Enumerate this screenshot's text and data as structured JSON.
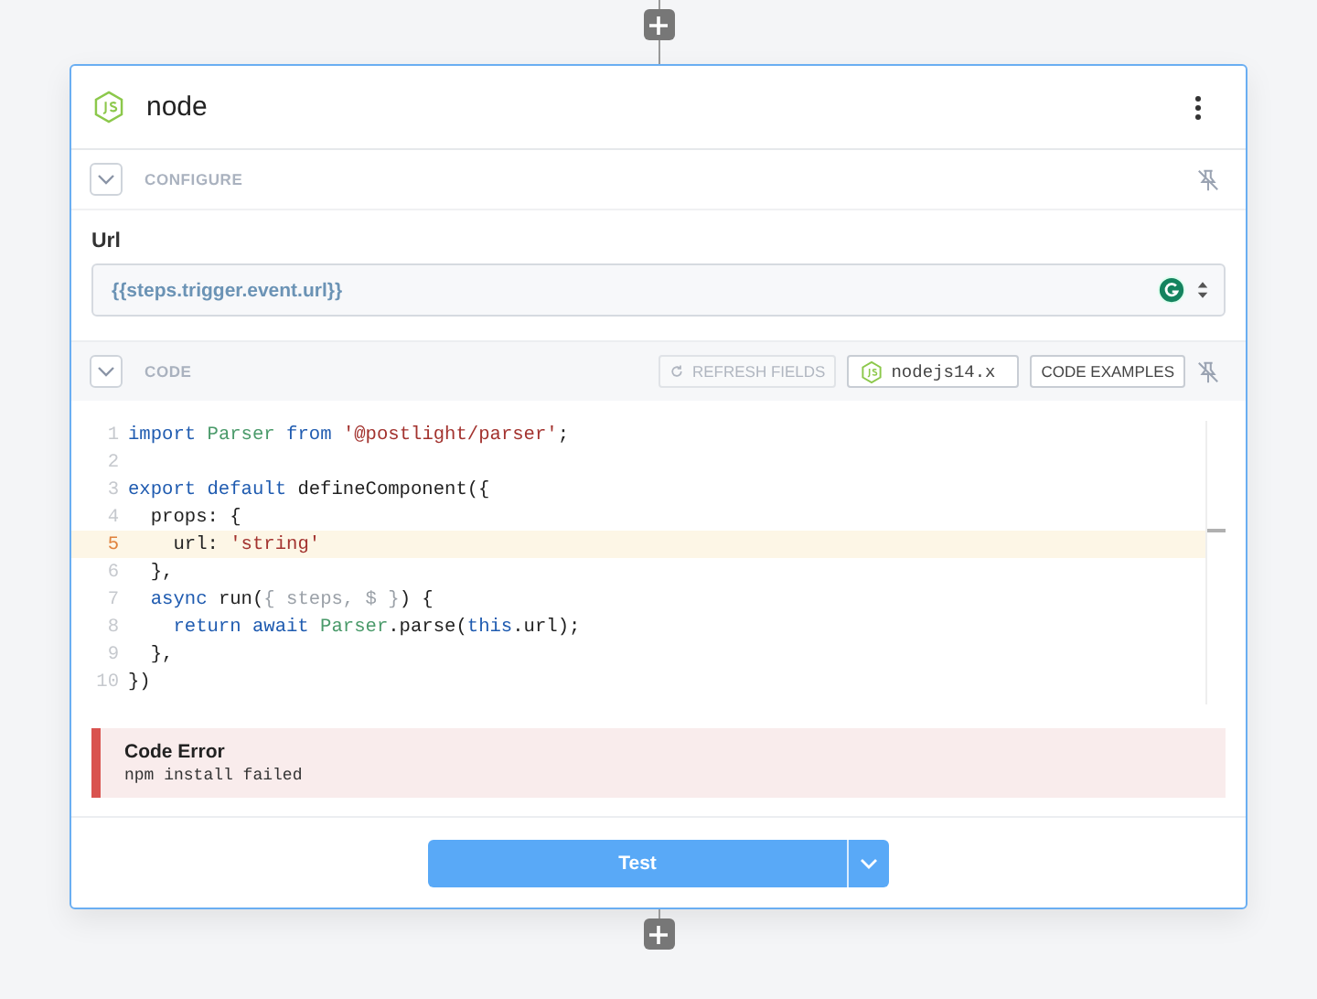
{
  "step": {
    "title": "node"
  },
  "configure": {
    "label": "CONFIGURE",
    "expanded": true
  },
  "url_field": {
    "label": "Url",
    "value": "{{steps.trigger.event.url}}"
  },
  "code_section": {
    "label": "CODE",
    "expanded": true,
    "refresh_button": "REFRESH FIELDS",
    "runtime": "nodejs14.x",
    "examples_button": "CODE EXAMPLES"
  },
  "code_lines": [
    {
      "number": "1",
      "current": false,
      "tokens": [
        {
          "kind": "keyword",
          "text": "import "
        },
        {
          "kind": "class",
          "text": "Parser "
        },
        {
          "kind": "keyword",
          "text": "from "
        },
        {
          "kind": "string",
          "text": "'@postlight/parser'"
        },
        {
          "kind": "plain",
          "text": ";"
        }
      ]
    },
    {
      "number": "2",
      "current": false
    },
    {
      "number": "3",
      "current": false,
      "tokens": [
        {
          "kind": "keyword",
          "text": "export default"
        },
        {
          "kind": "plain",
          "text": " defineComponent({"
        }
      ]
    },
    {
      "number": "4",
      "current": false,
      "tokens": [
        {
          "kind": "plain",
          "text": "  props: {"
        }
      ]
    },
    {
      "number": "5",
      "current": true,
      "tokens": [
        {
          "kind": "plain",
          "text": "    url: "
        },
        {
          "kind": "string",
          "text": "'string'"
        }
      ]
    },
    {
      "number": "6",
      "current": false,
      "tokens": [
        {
          "kind": "plain",
          "text": "  },"
        }
      ]
    },
    {
      "number": "7",
      "current": false,
      "tokens": [
        {
          "kind": "keyword",
          "text": "  async"
        },
        {
          "kind": "plain",
          "text": " run("
        },
        {
          "kind": "param",
          "text": "{ steps, $ }"
        },
        {
          "kind": "plain",
          "text": ") {"
        }
      ]
    },
    {
      "number": "8",
      "current": false,
      "tokens": [
        {
          "kind": "keyword",
          "text": "    return await "
        },
        {
          "kind": "class",
          "text": "Parser"
        },
        {
          "kind": "plain",
          "text": ".parse("
        },
        {
          "kind": "keyword",
          "text": "this"
        },
        {
          "kind": "plain",
          "text": ".url);"
        }
      ]
    },
    {
      "number": "9",
      "current": false,
      "tokens": [
        {
          "kind": "plain",
          "text": "  },"
        }
      ]
    },
    {
      "number": "10",
      "current": false,
      "tokens": [
        {
          "kind": "plain",
          "text": "})"
        }
      ]
    }
  ],
  "error": {
    "title": "Code Error",
    "message": "npm install failed"
  },
  "test_button": {
    "label": "Test"
  }
}
